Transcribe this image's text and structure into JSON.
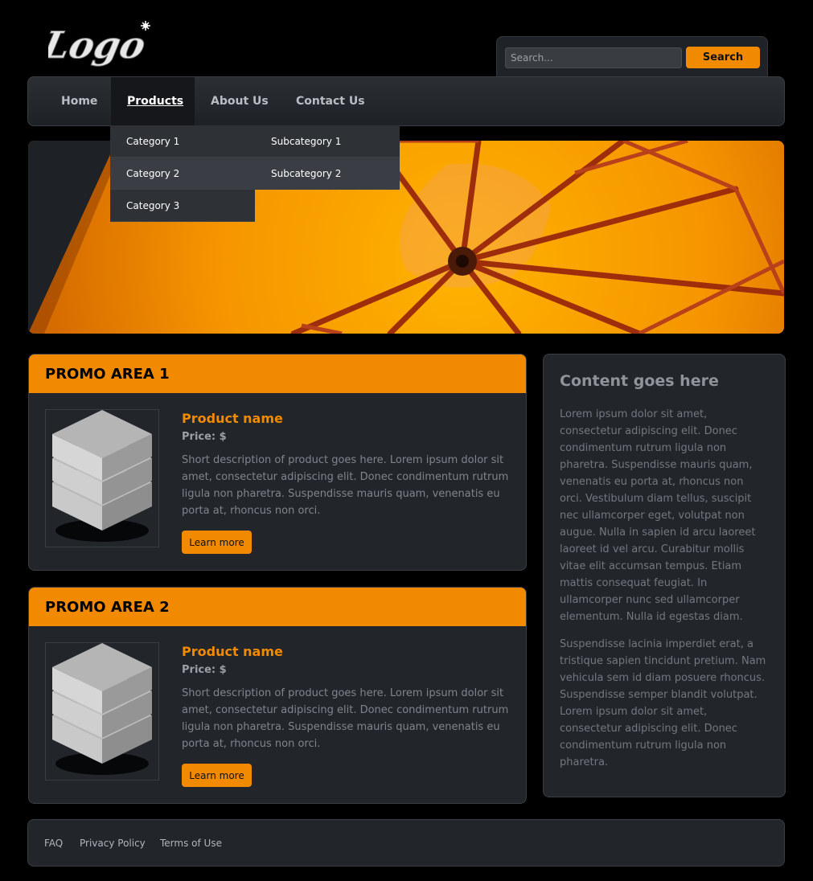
{
  "logo": {
    "text": "Logo"
  },
  "search": {
    "placeholder": "Search...",
    "button_label": "Search"
  },
  "nav": {
    "items": [
      {
        "label": "Home"
      },
      {
        "label": "Products",
        "active": true
      },
      {
        "label": "About Us"
      },
      {
        "label": "Contact Us"
      }
    ],
    "dropdown": [
      "Category 1",
      "Category 2",
      "Category 3"
    ],
    "subdropdown": [
      "Subcategory 1",
      "Subcategory 2"
    ]
  },
  "promos": [
    {
      "title": "PROMO AREA 1",
      "product_name": "Product name",
      "price": "Price: $",
      "description": "Short description of product goes here. Lorem ipsum dolor sit amet, consectetur adipiscing elit. Donec condimentum rutrum ligula non pharetra. Suspendisse mauris quam, venenatis eu porta at, rhoncus non orci.",
      "button_label": "Learn more"
    },
    {
      "title": "PROMO AREA 2",
      "product_name": "Product name",
      "price": "Price: $",
      "description": "Short description of product goes here. Lorem ipsum dolor sit amet, consectetur adipiscing elit. Donec condimentum rutrum ligula non pharetra. Suspendisse mauris quam, venenatis eu porta at, rhoncus non orci.",
      "button_label": "Learn more"
    }
  ],
  "sidebar": {
    "title": "Content goes here",
    "paragraphs": [
      "Lorem ipsum dolor sit amet, consectetur adipiscing elit. Donec condimentum rutrum ligula non pharetra. Suspendisse mauris quam, venenatis eu porta at, rhoncus non orci. Vestibulum diam tellus, suscipit nec ullamcorper eget, volutpat non augue. Nulla in sapien id arcu laoreet laoreet id vel arcu. Curabitur mollis vitae elit accumsan tempus. Etiam mattis consequat feugiat. In ullamcorper nunc sed ullamcorper elementum. Nulla id egestas diam.",
      "Suspendisse lacinia imperdiet erat, a tristique sapien tincidunt pretium. Nam vehicula sem id diam posuere rhoncus. Suspendisse semper blandit volutpat. Lorem ipsum dolor sit amet, consectetur adipiscing elit. Donec condimentum rutrum ligula non pharetra."
    ]
  },
  "footer": {
    "links": [
      "FAQ",
      "Privacy Policy",
      "Terms of Use"
    ]
  },
  "colors": {
    "accent": "#f28a00",
    "panel": "#22262b",
    "background": "#000000"
  },
  "icons": {
    "product": "server-stack-icon",
    "logo_star": "star-icon"
  }
}
